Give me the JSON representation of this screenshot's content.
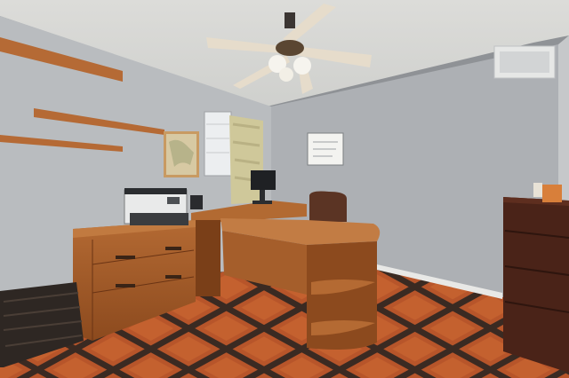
{
  "scene": {
    "kind": "photo",
    "subject": "home-office",
    "palette": {
      "ceiling": "#d9d9d6",
      "left_wall": "#b8bbbe",
      "back_wall": "#aeb1b5",
      "wood": "#a8612d",
      "wood_dark": "#7a3f18",
      "tile": "#b7552a",
      "grout": "#3a2a22",
      "baseboard": "#e8e8e6",
      "bookcase": "#4a2318"
    }
  }
}
